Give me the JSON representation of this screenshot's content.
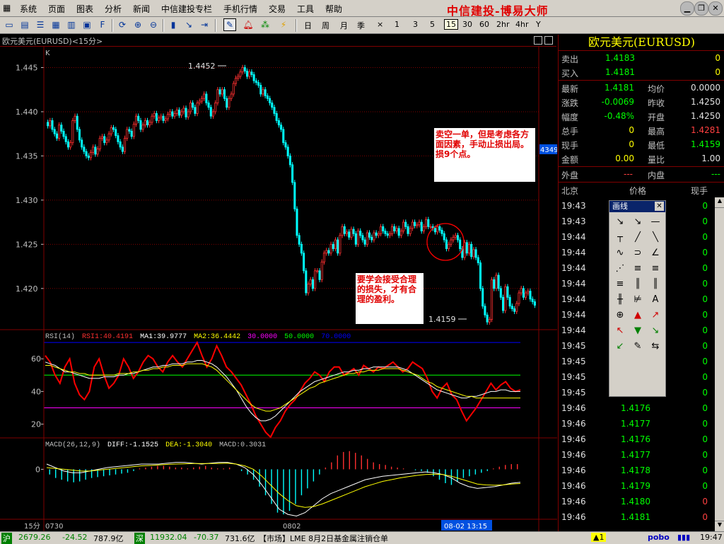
{
  "menu": {
    "items": [
      "系统",
      "页面",
      "图表",
      "分析",
      "新闻",
      "中信建投专栏",
      "手机行情",
      "交易",
      "工具",
      "帮助"
    ],
    "brand": "中信建投-博易大师"
  },
  "toolbar": {
    "periods": [
      "日",
      "周",
      "月",
      "季",
      "×",
      "1",
      "3",
      "5",
      "15",
      "30",
      "60",
      "2hr",
      "4hr",
      "Y"
    ],
    "selected_period": "15"
  },
  "chart_header": {
    "title": "欧元美元(EURUSD)<15分>",
    "k_label": "K"
  },
  "colors": {
    "up": "#ff3030",
    "down": "#00ffff",
    "grid": "#800000",
    "rsi_line": "#ff0000",
    "ma1": "#ffffff",
    "ma2": "#ffff00",
    "level30": "#ff00ff",
    "level50": "#00ff00",
    "level70": "#0000ff",
    "accent": "#ffff00"
  },
  "chart_data": [
    {
      "type": "candlestick",
      "title": "欧元美元(EURUSD)<15分>",
      "ylim": [
        1.4155,
        1.4472
      ],
      "yticks": [
        1.445,
        1.44,
        1.435,
        1.43,
        1.425,
        1.42
      ],
      "ytick_labels": [
        "1.445",
        "1.440",
        "1.435",
        "1.430",
        "1.425",
        "1.420"
      ],
      "x_labels": [
        "0730",
        "0802"
      ],
      "high_marker": "1.4452",
      "low_marker": "1.4159",
      "last_price_tag": "4349",
      "annotations": [
        "卖空一单，但是考虑各方面因素，手动止损出局。损9个点。",
        "要学会接受合理的损失，才有合理的盈利。"
      ],
      "closes": [
        1.4384,
        1.439,
        1.438,
        1.4375,
        1.437,
        1.4385,
        1.4378,
        1.4372,
        1.4366,
        1.436,
        1.4365,
        1.439,
        1.4395,
        1.438,
        1.4368,
        1.436,
        1.4355,
        1.435,
        1.4348,
        1.4354,
        1.436,
        1.4352,
        1.4358,
        1.437,
        1.4372,
        1.4365,
        1.4368,
        1.4375,
        1.4382,
        1.438,
        1.4373,
        1.4366,
        1.436,
        1.4355,
        1.437,
        1.438,
        1.4378,
        1.4372,
        1.4386,
        1.4395,
        1.439,
        1.438,
        1.4385,
        1.439,
        1.4385,
        1.4388,
        1.4395,
        1.4398,
        1.439,
        1.4393,
        1.4395,
        1.439,
        1.4392,
        1.4397,
        1.44,
        1.4395,
        1.4398,
        1.4402,
        1.4396,
        1.44,
        1.4404,
        1.4394,
        1.44,
        1.441,
        1.4405,
        1.4398,
        1.441,
        1.4412,
        1.4415,
        1.442,
        1.441,
        1.4405,
        1.4395,
        1.44,
        1.441,
        1.4425,
        1.442,
        1.4425,
        1.4415,
        1.4405,
        1.4415,
        1.442,
        1.4432,
        1.4438,
        1.444,
        1.4445,
        1.445,
        1.4446,
        1.444,
        1.4445,
        1.4442,
        1.4435,
        1.4433,
        1.443,
        1.442,
        1.4425,
        1.4418,
        1.4415,
        1.441,
        1.4405,
        1.4398,
        1.439,
        1.4385,
        1.438,
        1.4365,
        1.436,
        1.435,
        1.434,
        1.432,
        1.429,
        1.426,
        1.425,
        1.424,
        1.422,
        1.4195,
        1.4205,
        1.421,
        1.42,
        1.422,
        1.422,
        1.421,
        1.423,
        1.424,
        1.4243,
        1.424,
        1.425,
        1.4245,
        1.4255,
        1.424,
        1.426,
        1.427,
        1.4262,
        1.4264,
        1.4258,
        1.4267,
        1.4262,
        1.425,
        1.4265,
        1.426,
        1.4255,
        1.425,
        1.4263,
        1.4258,
        1.4255,
        1.4263,
        1.426,
        1.4262,
        1.427,
        1.4265,
        1.4262,
        1.426,
        1.4262,
        1.427,
        1.4265,
        1.4268,
        1.426,
        1.4265,
        1.4275,
        1.427,
        1.4262,
        1.4268,
        1.4275,
        1.4271,
        1.4272,
        1.4275,
        1.4265,
        1.427,
        1.4278,
        1.427,
        1.427,
        1.4268,
        1.4264,
        1.427,
        1.4266,
        1.4262,
        1.4255,
        1.4245,
        1.425,
        1.4255,
        1.4258,
        1.426,
        1.4255,
        1.4245,
        1.4235,
        1.4252,
        1.424,
        1.425,
        1.4236,
        1.4244,
        1.4235,
        1.4229,
        1.42,
        1.418,
        1.417,
        1.4162,
        1.4165,
        1.421,
        1.42,
        1.4215,
        1.42,
        1.419,
        1.4175,
        1.4202,
        1.419,
        1.418,
        1.4177,
        1.4174,
        1.4183,
        1.4195,
        1.42,
        1.419,
        1.4195,
        1.4197,
        1.4188,
        1.4185,
        1.4181
      ]
    },
    {
      "type": "line",
      "title": "RSI(14)",
      "readouts": [
        "RSI(14)",
        "RSI1:40.4191",
        "MA1:39.9777",
        "MA2:36.4442",
        "30.0000",
        "50.0000",
        "70.0000"
      ],
      "ylim": [
        12,
        77
      ],
      "yticks": [
        60,
        40,
        20
      ],
      "levels": [
        30,
        50,
        70
      ],
      "series": [
        {
          "name": "RSI1",
          "values": [
            62,
            58,
            50,
            45,
            55,
            60,
            45,
            38,
            35,
            40,
            55,
            60,
            50,
            42,
            45,
            50,
            60,
            55,
            48,
            52,
            58,
            62,
            60,
            55,
            52,
            58,
            62,
            58,
            55,
            60,
            65,
            70,
            62,
            55,
            60,
            68,
            62,
            55,
            52,
            48,
            44,
            38,
            32,
            25,
            20,
            15,
            12,
            18,
            22,
            28,
            32,
            35,
            40,
            45,
            48,
            52,
            50,
            46,
            52,
            55,
            55,
            50,
            52,
            54,
            50,
            56,
            54,
            52,
            55,
            54,
            56,
            58,
            55,
            52,
            54,
            58,
            56,
            54,
            48,
            40,
            36,
            42,
            45,
            38,
            35,
            28,
            22,
            26,
            30,
            35,
            40,
            45,
            41,
            44,
            46,
            42,
            40,
            41
          ]
        },
        {
          "name": "MA1",
          "values": [
            58,
            57,
            56,
            54,
            52,
            52,
            51,
            50,
            49,
            48,
            48,
            48,
            49,
            49,
            49,
            50,
            50,
            51,
            51,
            52,
            53,
            54,
            55,
            55,
            56,
            56,
            57,
            57,
            57,
            58,
            58,
            59,
            59,
            58,
            57,
            55,
            52,
            49,
            45,
            41,
            36,
            31,
            27,
            24,
            22,
            22,
            23,
            25,
            28,
            31,
            34,
            37,
            40,
            42,
            44,
            46,
            47,
            48,
            49,
            50,
            51,
            52,
            52,
            53,
            53,
            54,
            54,
            55,
            55,
            55,
            55,
            55,
            55,
            54,
            53,
            51,
            49,
            47,
            45,
            43,
            41,
            40,
            39,
            38,
            37,
            36,
            36,
            37,
            37,
            38,
            39,
            40,
            40,
            41,
            41,
            40,
            40,
            40
          ]
        },
        {
          "name": "MA2",
          "values": [
            56,
            56,
            55,
            54,
            53,
            52,
            52,
            51,
            51,
            50,
            50,
            50,
            50,
            50,
            50,
            51,
            51,
            51,
            52,
            52,
            53,
            53,
            54,
            54,
            55,
            55,
            56,
            56,
            56,
            57,
            57,
            57,
            57,
            56,
            55,
            53,
            50,
            47,
            44,
            41,
            38,
            35,
            32,
            30,
            29,
            28,
            28,
            29,
            30,
            32,
            34,
            36,
            38,
            40,
            42,
            43,
            45,
            46,
            47,
            48,
            49,
            50,
            51,
            51,
            52,
            52,
            53,
            53,
            53,
            54,
            54,
            54,
            54,
            53,
            52,
            51,
            50,
            48,
            46,
            45,
            43,
            42,
            41,
            40,
            39,
            38,
            37,
            37,
            36,
            36,
            36,
            36,
            36,
            36,
            36,
            36,
            36,
            36
          ]
        }
      ]
    },
    {
      "type": "bar",
      "title": "MACD(26,12,9)",
      "readouts": [
        "MACD(26,12,9)",
        "DIFF:-1.1525",
        "DEA:-1.3040",
        "MACD:0.3031"
      ],
      "ylim": [
        -2.8,
        1.2
      ],
      "yticks": [
        0
      ],
      "histogram": [
        -0.3,
        -0.5,
        -0.6,
        -0.7,
        -0.75,
        -0.7,
        -0.6,
        -0.5,
        -0.45,
        -0.4,
        -0.35,
        -0.3,
        -0.25,
        -0.2,
        -0.1,
        0.05,
        0.1,
        0.15,
        0.2,
        0.2,
        0.15,
        0.1,
        0.1,
        0.05,
        0.1,
        0.15,
        0.2,
        0.1,
        0.05,
        0.05,
        0.1,
        0.0,
        -0.1,
        -0.3,
        -0.6,
        -1.0,
        -1.5,
        -2.0,
        -2.5,
        -2.6,
        -2.4,
        -2.0,
        -1.5,
        -1.1,
        -0.7,
        -0.3,
        0.1,
        0.4,
        0.8,
        1.0,
        1.05,
        0.95,
        0.8,
        0.6,
        0.4,
        0.3,
        0.25,
        0.15,
        0.1,
        0.05,
        0.0,
        -0.05,
        -0.1,
        -0.2,
        -0.4,
        -0.6,
        -0.8,
        -0.9,
        -0.7,
        -0.5,
        -0.4,
        -0.3,
        -0.2,
        -0.1,
        0.05,
        0.15,
        0.25,
        0.3,
        0.3
      ],
      "series": [
        {
          "name": "DIFF",
          "values": [
            0.3,
            0.1,
            -0.1,
            -0.2,
            -0.2,
            -0.1,
            0.0,
            0.1,
            0.15,
            0.2,
            0.25,
            0.3,
            0.3,
            0.3,
            0.35,
            0.4,
            0.4,
            0.35,
            0.3,
            0.35,
            0.4,
            0.4,
            0.3,
            0.1,
            -0.3,
            -0.9,
            -1.6,
            -2.3,
            -2.6,
            -2.7,
            -2.5,
            -2.1,
            -1.7,
            -1.4,
            -1.2,
            -1.0,
            -0.8,
            -0.6,
            -0.5,
            -0.4,
            -0.35,
            -0.3,
            -0.25,
            -0.2,
            -0.15,
            -0.2,
            -0.3,
            -0.5,
            -0.8,
            -1.0,
            -1.1,
            -1.05,
            -1.0,
            -0.9,
            -0.8,
            -0.75
          ]
        },
        {
          "name": "DEA",
          "values": [
            0.1,
            0.05,
            0.0,
            -0.05,
            -0.1,
            -0.1,
            -0.05,
            0.0,
            0.05,
            0.1,
            0.15,
            0.2,
            0.22,
            0.25,
            0.28,
            0.3,
            0.32,
            0.33,
            0.33,
            0.33,
            0.34,
            0.35,
            0.3,
            0.2,
            0.0,
            -0.4,
            -0.9,
            -1.4,
            -1.8,
            -2.1,
            -2.2,
            -2.15,
            -2.0,
            -1.8,
            -1.6,
            -1.4,
            -1.2,
            -1.0,
            -0.85,
            -0.7,
            -0.6,
            -0.5,
            -0.42,
            -0.35,
            -0.3,
            -0.28,
            -0.3,
            -0.4,
            -0.55,
            -0.7,
            -0.85,
            -0.9,
            -0.92,
            -0.9,
            -0.85,
            -0.82
          ]
        }
      ]
    }
  ],
  "status_left": {
    "period": "15分",
    "first_date": "0730",
    "mid_date": "0802",
    "cursor_time": "08-02 13:15"
  },
  "quote": {
    "title": "欧元美元(EURUSD)",
    "rows1": [
      {
        "label": "卖出",
        "value": "1.4183",
        "vol": "0"
      },
      {
        "label": "买入",
        "value": "1.4181",
        "vol": "0"
      }
    ],
    "rows2": [
      {
        "l1": "最新",
        "v1": "1.4181",
        "l2": "均价",
        "v2": "0.0000"
      },
      {
        "l1": "涨跌",
        "v1": "-0.0069",
        "l2": "昨收",
        "v2": "1.4250"
      },
      {
        "l1": "幅度",
        "v1": "-0.48%",
        "l2": "开盘",
        "v2": "1.4250"
      },
      {
        "l1": "总手",
        "v1": "0",
        "l2": "最高",
        "v2": "1.4281"
      },
      {
        "l1": "现手",
        "v1": "0",
        "l2": "最低",
        "v2": "1.4159"
      },
      {
        "l1": "金额",
        "v1": "0.00",
        "l2": "量比",
        "v2": "1.00"
      }
    ],
    "outer_label": "外盘",
    "outer_value": "---",
    "inner_label": "内盘",
    "inner_value": "---",
    "tick_header": {
      "time": "北京",
      "price": "价格",
      "vol": "现手"
    },
    "ticks": [
      {
        "time": "19:43",
        "price": "",
        "vol": "0"
      },
      {
        "time": "19:43",
        "price": "",
        "vol": "0"
      },
      {
        "time": "19:44",
        "price": "",
        "vol": "0"
      },
      {
        "time": "19:44",
        "price": "",
        "vol": "0"
      },
      {
        "time": "19:44",
        "price": "",
        "vol": "0"
      },
      {
        "time": "19:44",
        "price": "",
        "vol": "0"
      },
      {
        "time": "19:44",
        "price": "",
        "vol": "0"
      },
      {
        "time": "19:44",
        "price": "",
        "vol": "0"
      },
      {
        "time": "19:44",
        "price": "",
        "vol": "0"
      },
      {
        "time": "19:45",
        "price": "",
        "vol": "0"
      },
      {
        "time": "19:45",
        "price": "",
        "vol": "0"
      },
      {
        "time": "19:45",
        "price": "",
        "vol": "0"
      },
      {
        "time": "19:45",
        "price": "",
        "vol": "0"
      },
      {
        "time": "19:46",
        "price": "1.4176",
        "vol": "0"
      },
      {
        "time": "19:46",
        "price": "1.4177",
        "vol": "0"
      },
      {
        "time": "19:46",
        "price": "1.4176",
        "vol": "0"
      },
      {
        "time": "19:46",
        "price": "1.4177",
        "vol": "0"
      },
      {
        "time": "19:46",
        "price": "1.4178",
        "vol": "0"
      },
      {
        "time": "19:46",
        "price": "1.4179",
        "vol": "0"
      },
      {
        "time": "19:46",
        "price": "1.4180",
        "vol": "0"
      },
      {
        "time": "19:46",
        "price": "1.4181",
        "vol": "0"
      }
    ]
  },
  "draw_palette": {
    "title": "画线",
    "tools": [
      "↘",
      "↘",
      "—",
      "┬",
      "╱",
      "╲",
      "∿",
      "⊃",
      "∠",
      "⋰",
      "≡",
      "≡",
      "≡",
      "║",
      "║",
      "╫",
      "⊭",
      "A",
      "⊕",
      "▲",
      "↗",
      "↖",
      "▼",
      "↘",
      "↙",
      "✎",
      "⇆"
    ]
  },
  "statusbar": {
    "sh_label": "沪",
    "sh_index": "2679.26",
    "sh_change": "-24.52",
    "sh_amount": "787.9亿",
    "sz_label": "深",
    "sz_index": "11932.04",
    "sz_change": "-70.37",
    "sz_amount": "731.6亿",
    "news": "【市场】LME 8月2日基金属注销仓单",
    "alert": "▲1",
    "logo": "pobo",
    "time": "19:47"
  }
}
